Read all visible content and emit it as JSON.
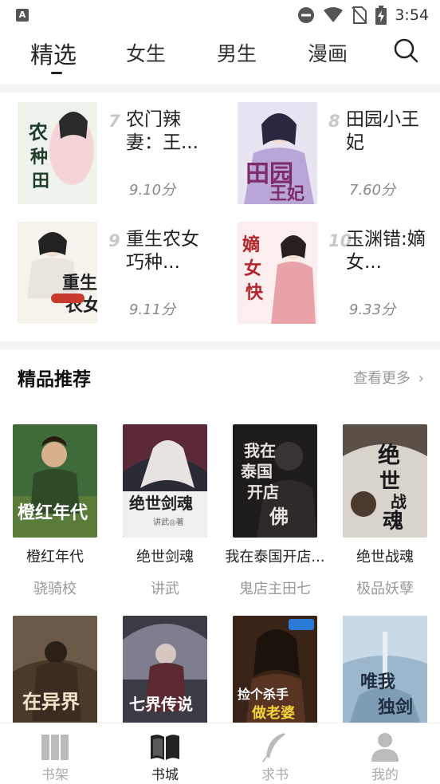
{
  "status": {
    "time": "3:54",
    "app_badge": "A"
  },
  "tabs": [
    {
      "label": "精选",
      "active": true
    },
    {
      "label": "女生",
      "active": false
    },
    {
      "label": "男生",
      "active": false
    },
    {
      "label": "漫画",
      "active": false
    }
  ],
  "ranking": [
    {
      "rank": "7",
      "title": "农门辣妻：王...",
      "score": "9.10分",
      "cover_text": "农门辣妻种田"
    },
    {
      "rank": "8",
      "title": "田园小王妃",
      "score": "7.60分",
      "cover_text": "田园王妃"
    },
    {
      "rank": "9",
      "title": "重生农女巧种...",
      "score": "9.11分",
      "cover_text": "重生农女"
    },
    {
      "rank": "10",
      "title": "玉渊错:嫡女...",
      "score": "9.33分",
      "cover_text": "嫡女快穿"
    }
  ],
  "section": {
    "title": "精品推荐",
    "more": "查看更多"
  },
  "books": [
    {
      "title": "橙红年代",
      "author": "骁骑校",
      "cover_text": "橙红年代",
      "color": "#3f6b3a"
    },
    {
      "title": "绝世剑魂",
      "author": "讲武",
      "cover_text": "绝世剑魂",
      "color": "#2b2b35"
    },
    {
      "title": "我在泰国开店...",
      "author": "鬼店主田七",
      "cover_text": "我在泰国开店",
      "color": "#1e1b1b"
    },
    {
      "title": "绝世战魂",
      "author": "极品妖孽",
      "cover_text": "绝世战魂",
      "color": "#d8d4cc"
    },
    {
      "title": "",
      "author": "",
      "cover_text": "在异界",
      "color": "#4a3a2a"
    },
    {
      "title": "",
      "author": "",
      "cover_text": "七界传说",
      "color": "#3b3b46"
    },
    {
      "title": "",
      "author": "",
      "cover_text": "捡个杀手做老婆",
      "color": "#3a2418"
    },
    {
      "title": "",
      "author": "",
      "cover_text": "唯我独剑",
      "color": "#9cb7cc"
    }
  ],
  "nav": [
    {
      "label": "书架",
      "icon": "bookshelf-icon",
      "active": false
    },
    {
      "label": "书城",
      "icon": "open-book-icon",
      "active": true
    },
    {
      "label": "求书",
      "icon": "feather-icon",
      "active": false
    },
    {
      "label": "我的",
      "icon": "user-icon",
      "active": false
    }
  ]
}
